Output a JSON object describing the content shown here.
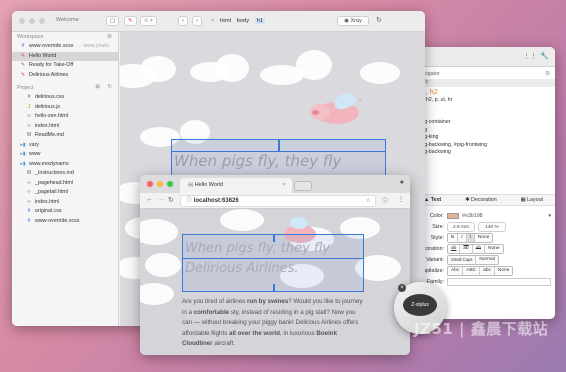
{
  "editor": {
    "title": "Welcome",
    "workspace_label": "Workspace",
    "workspace_items": [
      {
        "label": "www-override.scss",
        "extra": "… www.youtu",
        "icon": "scss"
      },
      {
        "label": "Hello World",
        "icon": "pig",
        "selected": true
      },
      {
        "label": "Ready for Take-Off",
        "icon": "pig"
      },
      {
        "label": "Delirious Airlines",
        "icon": "pig"
      }
    ],
    "project_label": "Project",
    "project_items": [
      {
        "label": "delirious.css",
        "icon": "css",
        "indent": 1
      },
      {
        "label": "delirious.js",
        "icon": "js",
        "indent": 1
      },
      {
        "label": "hello-zen.html",
        "icon": "html",
        "indent": 1
      },
      {
        "label": "index.html",
        "icon": "html",
        "indent": 1
      },
      {
        "label": "ReadMe.md",
        "icon": "md",
        "indent": 1
      },
      {
        "label": "vary",
        "icon": "folder",
        "indent": 0
      },
      {
        "label": "www",
        "icon": "folder",
        "indent": 0
      },
      {
        "label": "www.evsdynamo",
        "icon": "folder",
        "indent": 0
      },
      {
        "label": "_Instructions.md",
        "icon": "md",
        "indent": 1
      },
      {
        "label": "_pagehead.html",
        "icon": "html",
        "indent": 1
      },
      {
        "label": "_pagetail.html",
        "icon": "html",
        "indent": 1
      },
      {
        "label": "index.html",
        "icon": "html",
        "indent": 1
      },
      {
        "label": "original.css",
        "icon": "css",
        "indent": 1
      },
      {
        "label": "www-override.scss",
        "icon": "scss",
        "indent": 1
      }
    ]
  },
  "toolbar": {
    "crumbs": [
      "html",
      "body",
      "h1"
    ],
    "xray_label": "Xray"
  },
  "canvas": {
    "headline": "When pigs fly, they fly",
    "headline2": "Delirious Airlines."
  },
  "browser": {
    "tab_title": "Hello World",
    "url": "localhost:63626",
    "p_1": "Are you tired of airlines ",
    "p_b1": "run by swines",
    "p_2": "? Would you like to journey in a ",
    "p_b2": "comfortable",
    "p_3": " sty, instead of residing in a pig stall? Now you can — without breaking your piggy bank! Delirious Airlines offers affordable flights ",
    "p_b3": "all over the world",
    "p_4": ", in luxurious ",
    "p_b4": "Boeink Cloudliner",
    "p_5": " aircraft."
  },
  "inspector": {
    "navigator_label": "Navigator",
    "selectors": [
      "body",
      "h1, h2",
      "h1, h2, p, ul, hr",
      "a",
      "Hg",
      "#pig-container",
      "#pig",
      "#pig-king",
      "#pig-backwing, #pig-frontwing",
      "#pig-backwing"
    ],
    "tabs": [
      "Text",
      "Decoration",
      "Layout"
    ],
    "color_label": "Color:",
    "color_value": "#e3b198",
    "size_label": "Size:",
    "size_value": "2.6 mm",
    "size_value2": "140 %",
    "style_label": "Style:",
    "style_opts": [
      "B",
      "I",
      "I",
      "None"
    ],
    "decoration_label": "Decoration:",
    "decoration_opts": [
      "ab",
      "ab",
      "ab",
      "None"
    ],
    "variant_label": "Variant:",
    "variant_opts": [
      "Small Caps",
      "Normal"
    ],
    "capitalize_label": "Capitalize:",
    "capitalize_opts": [
      "Abc",
      "ABC",
      "abc",
      "None"
    ],
    "family_label": "Family:"
  },
  "stylus": {
    "label": "Z-stylus"
  },
  "watermark": "JZ51 | 鑫晨下载站",
  "colors": {
    "accent": "#3b78d8",
    "pink": "#e27aa0",
    "swatch": "#e3b198"
  }
}
